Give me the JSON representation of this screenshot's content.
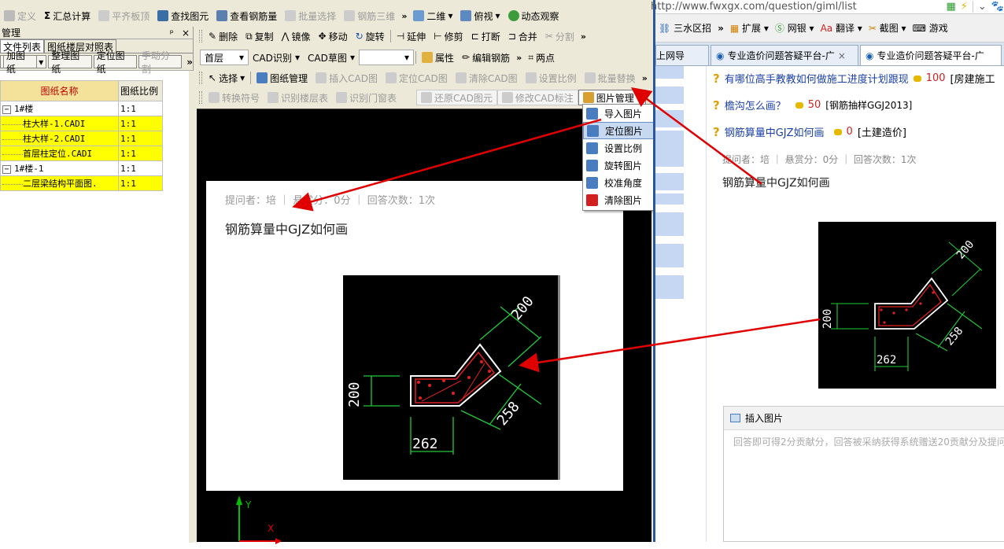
{
  "toolbar1": {
    "items": [
      "定义",
      "汇总计算",
      "平齐板顶",
      "查找图元",
      "查看钢筋量",
      "批量选择",
      "钢筋三维"
    ],
    "view2d": "二维",
    "view_top": "俯视",
    "dynamic": "动态观察"
  },
  "toolbar2": {
    "items": [
      "删除",
      "复制",
      "镜像",
      "移动",
      "旋转",
      "延伸",
      "修剪",
      "打断",
      "合并",
      "分割"
    ]
  },
  "toolbar3": {
    "floor": "首层",
    "cad_recog": "CAD识别",
    "cad_draft": "CAD草图",
    "attr": "属性",
    "edit_rebar": "编辑钢筋",
    "two_point": "两点"
  },
  "toolbar4": {
    "items": [
      "选择",
      "图纸管理",
      "插入CAD图",
      "定位CAD图",
      "清除CAD图",
      "设置比例",
      "批量替换"
    ]
  },
  "toolbar5": {
    "items": [
      "转换符号",
      "识别楼层表",
      "识别门窗表",
      "还原CAD图元",
      "修改CAD标注",
      "图片管理"
    ]
  },
  "panel": {
    "title": "管理",
    "pin": "ᵖ",
    "close": "×",
    "tabs": [
      "文件列表",
      "图纸楼层对照表"
    ],
    "buttons": [
      "加图纸",
      "整理图纸",
      "定位图纸",
      "手动分割"
    ],
    "columns": [
      "图纸名称",
      "图纸比例"
    ],
    "rows": [
      {
        "name": "1#楼",
        "scale": "1:1",
        "level": 0,
        "toggle": "−",
        "hl": false
      },
      {
        "name": "柱大样-1.CADI",
        "scale": "1:1",
        "level": 1,
        "toggle": "",
        "hl": true
      },
      {
        "name": "柱大样-2.CADI",
        "scale": "1:1",
        "level": 1,
        "toggle": "",
        "hl": true
      },
      {
        "name": "首层柱定位.CADI",
        "scale": "1:1",
        "level": 1,
        "toggle": "",
        "hl": true
      },
      {
        "name": "1#楼-1",
        "scale": "1:1",
        "level": 0,
        "toggle": "−",
        "hl": false
      },
      {
        "name": "二层梁结构平面图.",
        "scale": "1:1",
        "level": 1,
        "toggle": "",
        "hl": true
      }
    ]
  },
  "context_menu": {
    "items": [
      {
        "label": "导入图片",
        "selected": false
      },
      {
        "label": "定位图片",
        "selected": true
      },
      {
        "label": "设置比例",
        "selected": false
      },
      {
        "label": "旋转图片",
        "selected": false
      },
      {
        "label": "校准角度",
        "selected": false
      },
      {
        "label": "清除图片",
        "selected": false
      }
    ]
  },
  "canvas": {
    "meta": "提问者：培  ｜  悬赏分：0分  ｜  回答次数：1次",
    "title": "钢筋算量中GJZ如何画",
    "dims": {
      "d200_top": "200",
      "d200_left": "200",
      "d258": "258",
      "d262": "262"
    },
    "axis_x": "X",
    "axis_y": "Y"
  },
  "browser": {
    "url": "http://www.fwxgx.com/question/giml/list",
    "toolbar": [
      "三水区招",
      "扩展",
      "网银",
      "翻译",
      "截图",
      "游戏"
    ],
    "tabs": [
      "上网导",
      "专业造价问题答疑平台-广",
      "专业造价问题答疑平台-广"
    ],
    "questions": [
      {
        "title": "有哪位高手教教如何做施工进度计划跟现",
        "points": "100",
        "tag": "[房建施工"
      },
      {
        "title": "檐沟怎么画？",
        "points": "50",
        "tag": "[钢筋抽样GGJ2013]"
      },
      {
        "title": "钢筋算量中GJZ如何画",
        "points": "0",
        "tag": "[土建造价]"
      }
    ],
    "meta": "提问者：培   ｜   悬赏分：0分   ｜   回答次数：1次",
    "question_title": "钢筋算量中GJZ如何画",
    "insert_image": "插入图片",
    "answer_hint": "回答即可得2分贡献分，回答被采纳获得系统赠送20贡献分及提问"
  },
  "colors": {
    "highlight": "#ffff00",
    "arrow": "#e00000",
    "cad_bg": "#000000",
    "link": "#1a3fa8"
  }
}
